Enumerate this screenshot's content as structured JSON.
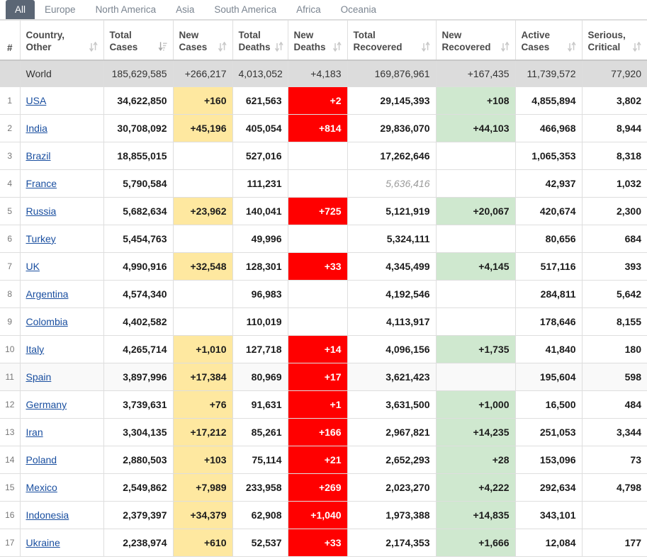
{
  "tabs": [
    {
      "label": "All",
      "active": true
    },
    {
      "label": "Europe",
      "active": false
    },
    {
      "label": "North America",
      "active": false
    },
    {
      "label": "Asia",
      "active": false
    },
    {
      "label": "South America",
      "active": false
    },
    {
      "label": "Africa",
      "active": false
    },
    {
      "label": "Oceania",
      "active": false
    }
  ],
  "columns": [
    {
      "key": "rank",
      "line1": "",
      "line2": "#",
      "sort": "none",
      "align": "center"
    },
    {
      "key": "country",
      "line1": "Country,",
      "line2": "Other",
      "sort": "sort",
      "align": "left"
    },
    {
      "key": "totcases",
      "line1": "Total",
      "line2": "Cases",
      "sort": "sort-desc",
      "align": "right"
    },
    {
      "key": "newcases",
      "line1": "New",
      "line2": "Cases",
      "sort": "sort",
      "align": "right"
    },
    {
      "key": "totdeaths",
      "line1": "Total",
      "line2": "Deaths",
      "sort": "sort",
      "align": "right"
    },
    {
      "key": "newdeaths",
      "line1": "New",
      "line2": "Deaths",
      "sort": "sort",
      "align": "right"
    },
    {
      "key": "totrec",
      "line1": "Total",
      "line2": "Recovered",
      "sort": "sort",
      "align": "right"
    },
    {
      "key": "newrec",
      "line1": "New",
      "line2": "Recovered",
      "sort": "sort",
      "align": "right"
    },
    {
      "key": "active",
      "line1": "Active",
      "line2": "Cases",
      "sort": "sort",
      "align": "right"
    },
    {
      "key": "serious",
      "line1": "Serious,",
      "line2": "Critical",
      "sort": "sort",
      "align": "right"
    }
  ],
  "world_row": {
    "rank": "",
    "country": "World",
    "totcases": "185,629,585",
    "newcases": "+266,217",
    "totdeaths": "4,013,052",
    "newdeaths": "+4,183",
    "totrec": "169,876,961",
    "newrec": "+167,435",
    "active": "11,739,572",
    "serious": "77,920"
  },
  "rows": [
    {
      "rank": "1",
      "country": "USA",
      "totcases": "34,622,850",
      "newcases": "+160",
      "totdeaths": "621,563",
      "newdeaths": "+2",
      "totrec": "29,145,393",
      "newrec": "+108",
      "active": "4,855,894",
      "serious": "3,802"
    },
    {
      "rank": "2",
      "country": "India",
      "totcases": "30,708,092",
      "newcases": "+45,196",
      "totdeaths": "405,054",
      "newdeaths": "+814",
      "totrec": "29,836,070",
      "newrec": "+44,103",
      "active": "466,968",
      "serious": "8,944"
    },
    {
      "rank": "3",
      "country": "Brazil",
      "totcases": "18,855,015",
      "newcases": "",
      "totdeaths": "527,016",
      "newdeaths": "",
      "totrec": "17,262,646",
      "newrec": "",
      "active": "1,065,353",
      "serious": "8,318"
    },
    {
      "rank": "4",
      "country": "France",
      "totcases": "5,790,584",
      "newcases": "",
      "totdeaths": "111,231",
      "newdeaths": "",
      "totrec": "5,636,416",
      "newrec": "",
      "active": "42,937",
      "serious": "1,032",
      "totrec_italic": true
    },
    {
      "rank": "5",
      "country": "Russia",
      "totcases": "5,682,634",
      "newcases": "+23,962",
      "totdeaths": "140,041",
      "newdeaths": "+725",
      "totrec": "5,121,919",
      "newrec": "+20,067",
      "active": "420,674",
      "serious": "2,300"
    },
    {
      "rank": "6",
      "country": "Turkey",
      "totcases": "5,454,763",
      "newcases": "",
      "totdeaths": "49,996",
      "newdeaths": "",
      "totrec": "5,324,111",
      "newrec": "",
      "active": "80,656",
      "serious": "684"
    },
    {
      "rank": "7",
      "country": "UK",
      "totcases": "4,990,916",
      "newcases": "+32,548",
      "totdeaths": "128,301",
      "newdeaths": "+33",
      "totrec": "4,345,499",
      "newrec": "+4,145",
      "active": "517,116",
      "serious": "393"
    },
    {
      "rank": "8",
      "country": "Argentina",
      "totcases": "4,574,340",
      "newcases": "",
      "totdeaths": "96,983",
      "newdeaths": "",
      "totrec": "4,192,546",
      "newrec": "",
      "active": "284,811",
      "serious": "5,642"
    },
    {
      "rank": "9",
      "country": "Colombia",
      "totcases": "4,402,582",
      "newcases": "",
      "totdeaths": "110,019",
      "newdeaths": "",
      "totrec": "4,113,917",
      "newrec": "",
      "active": "178,646",
      "serious": "8,155"
    },
    {
      "rank": "10",
      "country": "Italy",
      "totcases": "4,265,714",
      "newcases": "+1,010",
      "totdeaths": "127,718",
      "newdeaths": "+14",
      "totrec": "4,096,156",
      "newrec": "+1,735",
      "active": "41,840",
      "serious": "180"
    },
    {
      "rank": "11",
      "country": "Spain",
      "totcases": "3,897,996",
      "newcases": "+17,384",
      "totdeaths": "80,969",
      "newdeaths": "+17",
      "totrec": "3,621,423",
      "newrec": "",
      "active": "195,604",
      "serious": "598",
      "alt": true
    },
    {
      "rank": "12",
      "country": "Germany",
      "totcases": "3,739,631",
      "newcases": "+76",
      "totdeaths": "91,631",
      "newdeaths": "+1",
      "totrec": "3,631,500",
      "newrec": "+1,000",
      "active": "16,500",
      "serious": "484"
    },
    {
      "rank": "13",
      "country": "Iran",
      "totcases": "3,304,135",
      "newcases": "+17,212",
      "totdeaths": "85,261",
      "newdeaths": "+166",
      "totrec": "2,967,821",
      "newrec": "+14,235",
      "active": "251,053",
      "serious": "3,344"
    },
    {
      "rank": "14",
      "country": "Poland",
      "totcases": "2,880,503",
      "newcases": "+103",
      "totdeaths": "75,114",
      "newdeaths": "+21",
      "totrec": "2,652,293",
      "newrec": "+28",
      "active": "153,096",
      "serious": "73"
    },
    {
      "rank": "15",
      "country": "Mexico",
      "totcases": "2,549,862",
      "newcases": "+7,989",
      "totdeaths": "233,958",
      "newdeaths": "+269",
      "totrec": "2,023,270",
      "newrec": "+4,222",
      "active": "292,634",
      "serious": "4,798"
    },
    {
      "rank": "16",
      "country": "Indonesia",
      "totcases": "2,379,397",
      "newcases": "+34,379",
      "totdeaths": "62,908",
      "newdeaths": "+1,040",
      "totrec": "1,973,388",
      "newrec": "+14,835",
      "active": "343,101",
      "serious": ""
    },
    {
      "rank": "17",
      "country": "Ukraine",
      "totcases": "2,238,974",
      "newcases": "+610",
      "totdeaths": "52,537",
      "newdeaths": "+33",
      "totrec": "2,174,353",
      "newrec": "+1,666",
      "active": "12,084",
      "serious": "177"
    }
  ],
  "colors": {
    "new_cases_bg": "#fee8a0",
    "new_deaths_bg": "#ff0000",
    "new_recovered_bg": "#cfe8cf",
    "world_row_bg": "#dcdcdc",
    "active_tab_bg": "#5b6675",
    "link": "#1a4fa0"
  },
  "icons": {
    "sort": "sort-icon",
    "sort_desc": "sort-amount-desc-icon"
  }
}
